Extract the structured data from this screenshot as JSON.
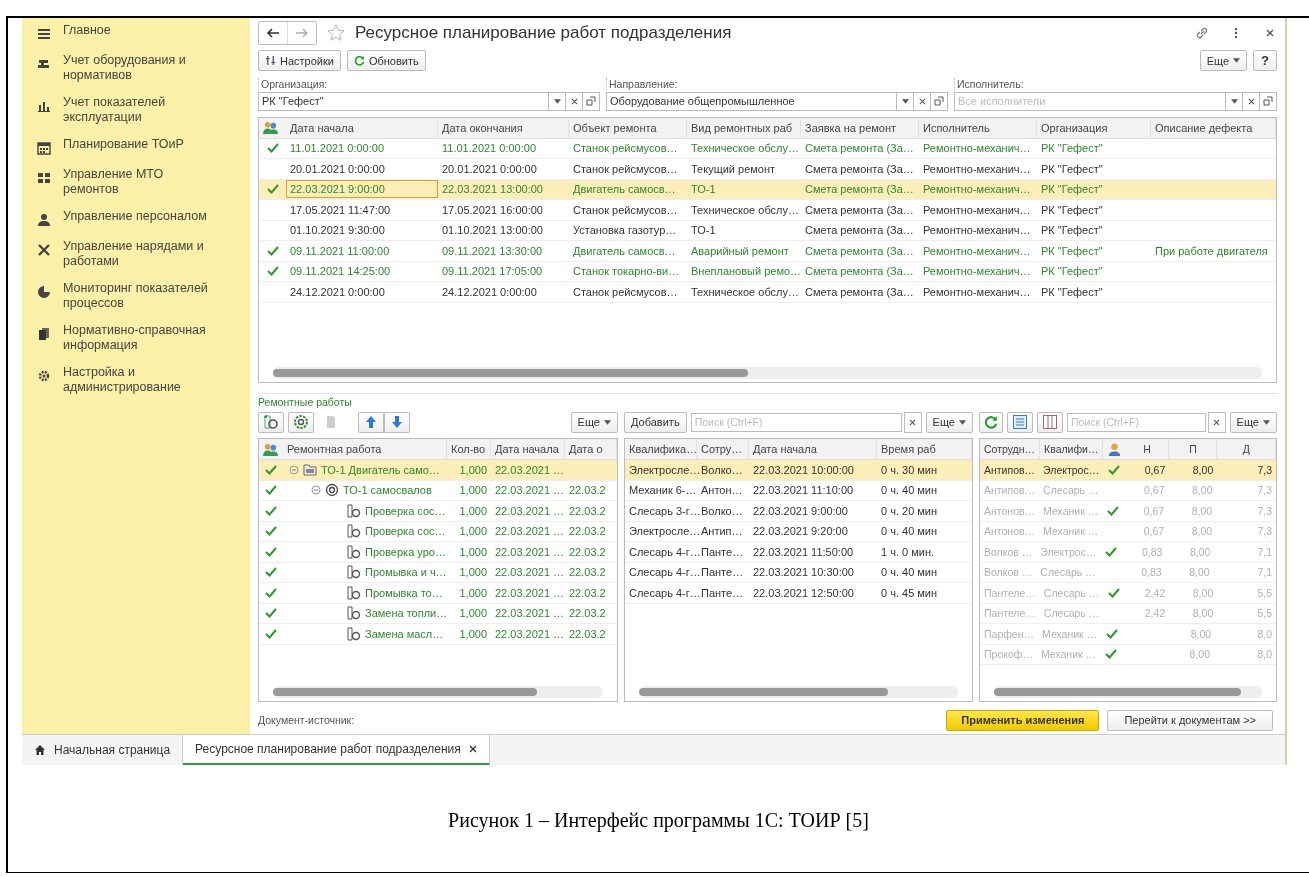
{
  "sidebar": {
    "items": [
      {
        "label": "Главное"
      },
      {
        "label": "Учет оборудования и нормативов"
      },
      {
        "label": "Учет показателей эксплуатации"
      },
      {
        "label": "Планирование ТОиР"
      },
      {
        "label": "Управление МТО ремонтов"
      },
      {
        "label": "Управление персоналом"
      },
      {
        "label": "Управление нарядами и работами"
      },
      {
        "label": "Мониторинг показателей процессов"
      },
      {
        "label": "Нормативно-справочная информация"
      },
      {
        "label": "Настройка и администрирование"
      }
    ]
  },
  "window": {
    "title": "Ресурсное планирование работ подразделения"
  },
  "toolbar": {
    "settings": "Настройки",
    "refresh": "Обновить",
    "more": "Еще",
    "help": "?"
  },
  "filters": [
    {
      "label": "Организация:",
      "value": "РК \"Гефест\""
    },
    {
      "label": "Направление:",
      "value": "Оборудование общепромышленное"
    },
    {
      "label": "Исполнитель:",
      "placeholder": "Все исполнители"
    }
  ],
  "plan_table": {
    "columns": [
      "Дата начала",
      "Дата окончания",
      "Объект ремонта",
      "Вид ремонтных раб",
      "Заявка на ремонт",
      "Исполнитель",
      "Организация",
      "Описание дефекта"
    ],
    "rows": [
      {
        "done": true,
        "selected": false,
        "start": "11.01.2021 0:00:00",
        "end": "11.01.2021 0:00:00",
        "object": "Станок рейсмусов…",
        "work_type": "Техническое обслу…",
        "request": "Смета ремонта (За…",
        "executor": "Ремонтно-механич…",
        "org": "РК \"Гефест\""
      },
      {
        "done": false,
        "selected": false,
        "start": "20.01.2021 0:00:00",
        "end": "20.01.2021 0:00:00",
        "object": "Станок рейсмусов…",
        "work_type": "Текущий ремонт",
        "request": "Смета ремонта (За…",
        "executor": "Ремонтно-механич…",
        "org": "РК \"Гефест\""
      },
      {
        "done": true,
        "selected": true,
        "start": "22.03.2021 9:00:00",
        "end": "22.03.2021 13:00:00",
        "object": "Двигатель самосв…",
        "work_type": "ТО-1",
        "request": "Смета ремонта (За…",
        "executor": "Ремонтно-механич…",
        "org": "РК \"Гефест\""
      },
      {
        "done": false,
        "selected": false,
        "start": "17.05.2021 11:47:00",
        "end": "17.05.2021 16:00:00",
        "object": "Станок рейсмусов…",
        "work_type": "Техническое обслу…",
        "request": "Смета ремонта (За…",
        "executor": "Ремонтно-механич…",
        "org": "РК \"Гефест\""
      },
      {
        "done": false,
        "selected": false,
        "start": "01.10.2021 9:30:00",
        "end": "01.10.2021 13:00:00",
        "object": "Установка газотур…",
        "work_type": "ТО-1",
        "request": "Смета ремонта (За…",
        "executor": "Ремонтно-механич…",
        "org": "РК \"Гефест\""
      },
      {
        "done": true,
        "selected": false,
        "start": "09.11.2021 11:00:00",
        "end": "09.11.2021 13:30:00",
        "object": "Двигатель самосв…",
        "work_type": "Аварийный ремонт",
        "request": "Смета ремонта (За…",
        "executor": "Ремонтно-механич…",
        "org": "РК \"Гефест\"",
        "defect": "При работе двигателя"
      },
      {
        "done": true,
        "selected": false,
        "start": "09.11.2021 14:25:00",
        "end": "09.11.2021 17:05:00",
        "object": "Станок токарно-ви…",
        "work_type": "Внеплановый ремо…",
        "request": "Смета ремонта (За…",
        "executor": "Ремонтно-механич…",
        "org": "РК \"Гефест\""
      },
      {
        "done": false,
        "selected": false,
        "start": "24.12.2021 0:00:00",
        "end": "24.12.2021 0:00:00",
        "object": "Станок рейсмусов…",
        "work_type": "Техническое обслу…",
        "request": "Смета ремонта (За…",
        "executor": "Ремонтно-механич…",
        "org": "РК \"Гефест\""
      }
    ]
  },
  "works": {
    "title": "Ремонтные работы",
    "more": "Еще",
    "tools": [
      {
        "kind": "add-task",
        "disabled": false
      },
      {
        "kind": "operation",
        "disabled": false
      },
      {
        "kind": "document",
        "disabled": true
      },
      {
        "kind": "up",
        "disabled": false
      },
      {
        "kind": "down",
        "disabled": false
      }
    ],
    "columns": [
      "Ремонтная работа",
      "Кол-во",
      "Дата начала",
      "Дата о"
    ],
    "items": [
      {
        "kind": "group",
        "done": true,
        "selected": true,
        "expanded": true,
        "name": "ТО-1 Двигатель само…",
        "qty": "1,000",
        "start": "22.03.2021 …",
        "children": [
          {
            "kind": "operation",
            "done": true,
            "selected": false,
            "expanded": true,
            "name": "ТО-1 самосвалов",
            "qty": "1,000",
            "start": "22.03.2021 …",
            "end": "22.03.2",
            "children": [
              {
                "kind": "task",
                "done": true,
                "selected": false,
                "name": "Проверка сос…",
                "qty": "1,000",
                "start": "22.03.2021 …",
                "end": "22.03.2"
              },
              {
                "kind": "task",
                "done": true,
                "selected": false,
                "name": "Проверка сос…",
                "qty": "1,000",
                "start": "22.03.2021 …",
                "end": "22.03.2"
              },
              {
                "kind": "task",
                "done": true,
                "selected": false,
                "name": "Проверка уро…",
                "qty": "1,000",
                "start": "22.03.2021 …",
                "end": "22.03.2"
              },
              {
                "kind": "task",
                "done": true,
                "selected": false,
                "name": "Промывка и ч…",
                "qty": "1,000",
                "start": "22.03.2021 …",
                "end": "22.03.2"
              },
              {
                "kind": "task",
                "done": true,
                "selected": false,
                "name": "Промывка то…",
                "qty": "1,000",
                "start": "22.03.2021 …",
                "end": "22.03.2"
              },
              {
                "kind": "task",
                "done": true,
                "selected": false,
                "name": "Замена топли…",
                "qty": "1,000",
                "start": "22.03.2021 …",
                "end": "22.03.2"
              },
              {
                "kind": "task",
                "done": true,
                "selected": false,
                "name": "Замена масл…",
                "qty": "1,000",
                "start": "22.03.2021 …",
                "end": "22.03.2"
              }
            ]
          }
        ]
      }
    ]
  },
  "assignments": {
    "add": "Добавить",
    "search_placeholder": "Поиск (Ctrl+F)",
    "more": "Еще",
    "columns": [
      "Квалифика…",
      "Сотру…",
      "Дата начала",
      "Время раб"
    ],
    "rows": [
      {
        "selected": true,
        "cells": [
          "Электросле…",
          "Волко…",
          "22.03.2021 10:00:00",
          "0 ч. 30 мин"
        ]
      },
      {
        "selected": false,
        "cells": [
          "Механик 6-…",
          "Антон…",
          "22.03.2021 11:10:00",
          "0 ч. 40 мин"
        ]
      },
      {
        "selected": false,
        "cells": [
          "Слесарь 3-г…",
          "Волко…",
          "22.03.2021 9:00:00",
          "0 ч. 20 мин"
        ]
      },
      {
        "selected": false,
        "cells": [
          "Электросле…",
          "Антип…",
          "22.03.2021 9:20:00",
          "0 ч. 40 мин"
        ]
      },
      {
        "selected": false,
        "cells": [
          "Слесарь 4-г…",
          "Панте…",
          "22.03.2021 11:50:00",
          "1 ч. 0 мин."
        ]
      },
      {
        "selected": false,
        "cells": [
          "Слесарь 4-г…",
          "Панте…",
          "22.03.2021 10:30:00",
          "0 ч. 40 мин"
        ]
      },
      {
        "selected": false,
        "cells": [
          "Слесарь 4-г…",
          "Панте…",
          "22.03.2021 12:50:00",
          "0 ч. 45 мин"
        ]
      }
    ]
  },
  "staff": {
    "search_placeholder": "Поиск (Ctrl+F)",
    "more": "Еще",
    "columns": [
      "Сотрудн…",
      "Квалифи…",
      "Н",
      "П",
      "Д"
    ],
    "rows": [
      {
        "selected": true,
        "inactive": false,
        "checked": true,
        "employee": "Антипов…",
        "qualification": "Электрос…",
        "n": "0,67",
        "p": "8,00",
        "d": "7,3"
      },
      {
        "selected": false,
        "inactive": true,
        "checked": false,
        "employee": "Антипов…",
        "qualification": "Слесарь …",
        "n": "0,67",
        "p": "8,00",
        "d": "7,3"
      },
      {
        "selected": false,
        "inactive": true,
        "checked": true,
        "employee": "Антонов…",
        "qualification": "Механик …",
        "n": "0,67",
        "p": "8,00",
        "d": "7,3"
      },
      {
        "selected": false,
        "inactive": true,
        "checked": false,
        "employee": "Антонов…",
        "qualification": "Механик …",
        "n": "0,67",
        "p": "8,00",
        "d": "7,3"
      },
      {
        "selected": false,
        "inactive": true,
        "checked": true,
        "employee": "Волков …",
        "qualification": "Электрос…",
        "n": "0,83",
        "p": "8,00",
        "d": "7,1"
      },
      {
        "selected": false,
        "inactive": true,
        "checked": false,
        "employee": "Волков …",
        "qualification": "Слесарь …",
        "n": "0,83",
        "p": "8,00",
        "d": "7,1"
      },
      {
        "selected": false,
        "inactive": true,
        "checked": true,
        "employee": "Пантеле…",
        "qualification": "Слесарь …",
        "n": "2,42",
        "p": "8,00",
        "d": "5,5"
      },
      {
        "selected": false,
        "inactive": true,
        "checked": false,
        "employee": "Пантеле…",
        "qualification": "Слесарь …",
        "n": "2,42",
        "p": "8,00",
        "d": "5,5"
      },
      {
        "selected": false,
        "inactive": true,
        "checked": true,
        "employee": "Парфен…",
        "qualification": "Механик …",
        "p": "8,00",
        "d": "8,0"
      },
      {
        "selected": false,
        "inactive": true,
        "checked": true,
        "employee": "Прокоф…",
        "qualification": "Механик …",
        "p": "8,00",
        "d": "8,0"
      }
    ]
  },
  "footer": {
    "source_label": "Документ-источник:",
    "apply": "Применить изменения",
    "goto": "Перейти к документам >>"
  },
  "tabs": [
    {
      "kind": "home",
      "label": "Начальная страница",
      "selected": false
    },
    {
      "kind": "document",
      "label": "Ресурсное планирование работ подразделения",
      "selected": true
    }
  ],
  "caption": "Рисунок 1 – Интерфейс программы 1С: ТОИР [5]"
}
